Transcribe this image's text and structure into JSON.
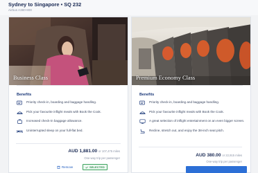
{
  "header": {
    "flight_title": "Sydney to Singapore • SQ 232",
    "aircraft": "Airbus A380-800"
  },
  "cards": [
    {
      "cabin": "Business Class",
      "benefits_title": "Benefits",
      "benefits": [
        {
          "icon": "checkin-icon",
          "text": "Priority check-in, boarding and baggage handling."
        },
        {
          "icon": "meal-icon",
          "text": "Pick your favourite inflight meals with Book the Cook."
        },
        {
          "icon": "baggage-icon",
          "text": "Increased check-in baggage allowance."
        },
        {
          "icon": "flat-bed-icon",
          "text": "Uninterrupted sleep on your full-flat bed."
        }
      ],
      "price": "AUD 1,881.00",
      "miles": "or 107,475 miles",
      "price_note": "One-way trip per passenger",
      "remove_label": "Remove",
      "selected_label": "SELECTED"
    },
    {
      "cabin": "Premium Economy Class",
      "benefits_title": "Benefits",
      "benefits": [
        {
          "icon": "checkin-icon",
          "text": "Priority check-in, boarding and baggage handling."
        },
        {
          "icon": "meal-icon",
          "text": "Pick your favourite inflight meals with Book the Cook."
        },
        {
          "icon": "screen-icon",
          "text": "A great selection of inflight entertainment on an even bigger screen."
        },
        {
          "icon": "recline-seat-icon",
          "text": "Recline, stretch out, and enjoy the 38-inch seat pitch."
        }
      ],
      "price": "AUD 380.00",
      "miles": "or 22,915 miles",
      "price_note": "One-way trip per passenger"
    }
  ],
  "colors": {
    "title": "#1b2b55",
    "link": "#1d5bbf",
    "selected_green": "#3da35d",
    "select_blue": "#2c6fd6"
  }
}
